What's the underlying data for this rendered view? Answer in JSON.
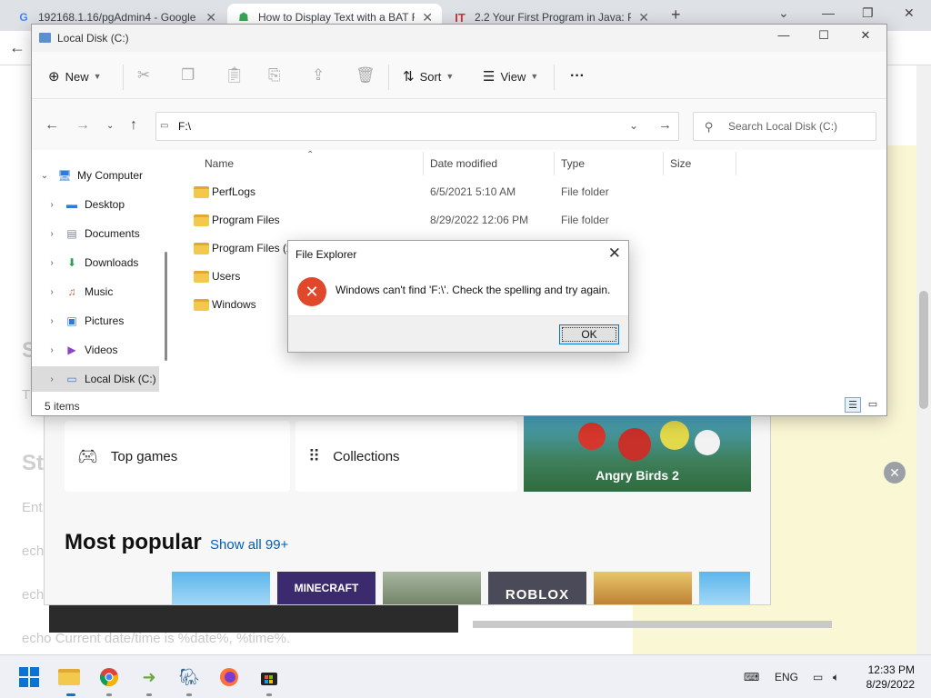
{
  "browser": {
    "tabs": [
      {
        "label": "192168.1.16/pgAdmin4 - Google",
        "favicon": "G"
      },
      {
        "label": "How to Display Text with a BAT F",
        "favicon": "wikihow"
      },
      {
        "label": "2.2 Your First Program in Java: Pr",
        "favicon": "IT"
      }
    ],
    "new_tab": "+",
    "page_lines": [
      "S",
      "T",
      "St",
      "Ent",
      "ech",
      "ech",
      "echo Current date/time is %date%, %time%."
    ]
  },
  "store": {
    "cards": [
      {
        "label": "Top games",
        "icon": "gamepad-icon"
      },
      {
        "label": "Collections",
        "icon": "grid-icon"
      }
    ],
    "featured_label": "Angry Birds 2",
    "popular_title": "Most popular",
    "popular_link": "Show all 99+",
    "thumbnails": [
      "",
      "MINECRAFT",
      "",
      "ROBLOX",
      "",
      ""
    ]
  },
  "explorer": {
    "title": "Local Disk (C:)",
    "commands": {
      "new": "New",
      "sort": "Sort",
      "view": "View",
      "more": "···"
    },
    "address_value": "F:\\",
    "search_placeholder": "Search Local Disk (C:)",
    "tree": [
      {
        "label": "My Computer",
        "expanded": true
      },
      {
        "label": "Desktop"
      },
      {
        "label": "Documents"
      },
      {
        "label": "Downloads"
      },
      {
        "label": "Music"
      },
      {
        "label": "Pictures"
      },
      {
        "label": "Videos"
      },
      {
        "label": "Local Disk (C:)",
        "selected": true
      }
    ],
    "columns": {
      "name": "Name",
      "date": "Date modified",
      "type": "Type",
      "size": "Size"
    },
    "files": [
      {
        "name": "PerfLogs",
        "date": "6/5/2021 5:10 AM",
        "type": "File folder"
      },
      {
        "name": "Program Files",
        "date": "8/29/2022 12:06 PM",
        "type": "File folder"
      },
      {
        "name": "Program Files (x",
        "date": "",
        "type": ""
      },
      {
        "name": "Users",
        "date": "",
        "type": ""
      },
      {
        "name": "Windows",
        "date": "",
        "type": ""
      }
    ],
    "item_count": "5 items"
  },
  "dialog": {
    "title": "File Explorer",
    "message": "Windows can't find 'F:\\'. Check the spelling and try again.",
    "ok_label": "OK"
  },
  "taskbar": {
    "language": "ENG",
    "time": "12:33 PM",
    "date": "8/29/2022"
  },
  "colors": {
    "accent": "#0078d4",
    "error": "#e0472b",
    "folder": "#f2c94c",
    "link": "#005fb8"
  }
}
